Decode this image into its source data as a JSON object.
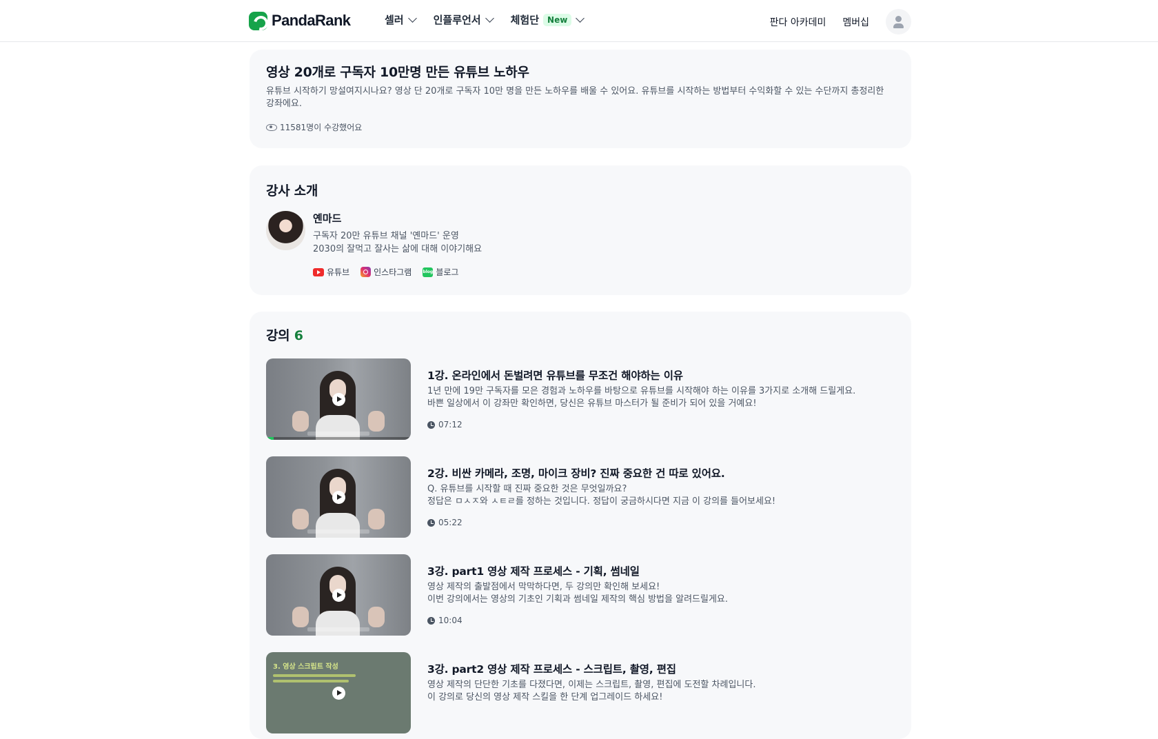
{
  "header": {
    "logo_text": "PandaRank",
    "nav": [
      {
        "label": "셀러"
      },
      {
        "label": "인플루언서"
      },
      {
        "label": "체험단",
        "badge": "New"
      }
    ],
    "academy_label": "판다 아카데미",
    "membership_label": "멤버십"
  },
  "course": {
    "title": "영상 20개로 구독자 10만명 만든 유튜브 노하우",
    "description": "유튜브 시작하기 망설여지시나요? 영상 단 20개로 구독자 10만 명을 만든 노하우를 배울 수 있어요. 유튜브를 시작하는 방법부터 수익화할 수 있는 수단까지 총정리한 강좌에요.",
    "students": "11581명이 수강했어요"
  },
  "instructor": {
    "section_title": "강사 소개",
    "name": "옌마드",
    "line1": "구독자 20만 유튜브 채널 '옌마드' 운영",
    "line2": "2030의 잘먹고 잘사는 삶에 대해 이야기해요",
    "socials": {
      "youtube": "유튜브",
      "instagram": "인스타그램",
      "blog": "블로그",
      "blog_icon_text": "blog"
    }
  },
  "lectures": {
    "section_title": "강의",
    "count": "6",
    "items": [
      {
        "title": "1강. 온라인에서 돈벌려면 유튜브를 무조건 해야하는 이유",
        "desc1": "1년 만에 19만 구독자를 모은 경험과 노하우를 바탕으로 유튜브를 시작해야 하는 이유를 3가지로 소개해 드릴게요.",
        "desc2": "바쁜 일상에서 이 강좌만 확인하면, 당신은 유튜브 마스터가 될 준비가 되어 있을 거예요!",
        "duration": "07:12",
        "watched_fraction": 0.05
      },
      {
        "title": "2강. 비싼 카메라, 조명, 마이크 장비? 진짜 중요한 건 따로 있어요.",
        "desc1": "Q. 유튜브를 시작할 때 진짜 중요한 것은 무엇일까요?",
        "desc2": "정답은 ㅁㅅㅈ와 ㅅㅌㄹ를 정하는 것입니다. 정답이 궁금하시다면 지금 이 강의를 들어보세요!",
        "duration": "05:22"
      },
      {
        "title": "3강. part1 영상 제작 프로세스 - 기획, 썸네일",
        "desc1": "영상 제작의 출발점에서 막막하다면, 두 강의만 확인해 보세요!",
        "desc2": "이번 강의에서는 영상의 기초인 기획과 썸네일 제작의 핵심 방법을 알려드릴게요.",
        "duration": "10:04"
      },
      {
        "title": "3강. part2 영상 제작 프로세스 - 스크립트, 촬영, 편집",
        "desc1": "영상 제작의 단단한 기초를 다졌다면, 이제는 스크립트, 촬영, 편집에 도전할 차례입니다.",
        "desc2": "이 강의로 당신의 영상 제작 스킬을 한 단계 업그레이드 하세요!",
        "slide_title": "3. 영상 스크립트 작성"
      }
    ]
  },
  "colors": {
    "accent": "#15803d",
    "card_bg": "#f7f8fa",
    "youtube": "#ef2b2b"
  }
}
